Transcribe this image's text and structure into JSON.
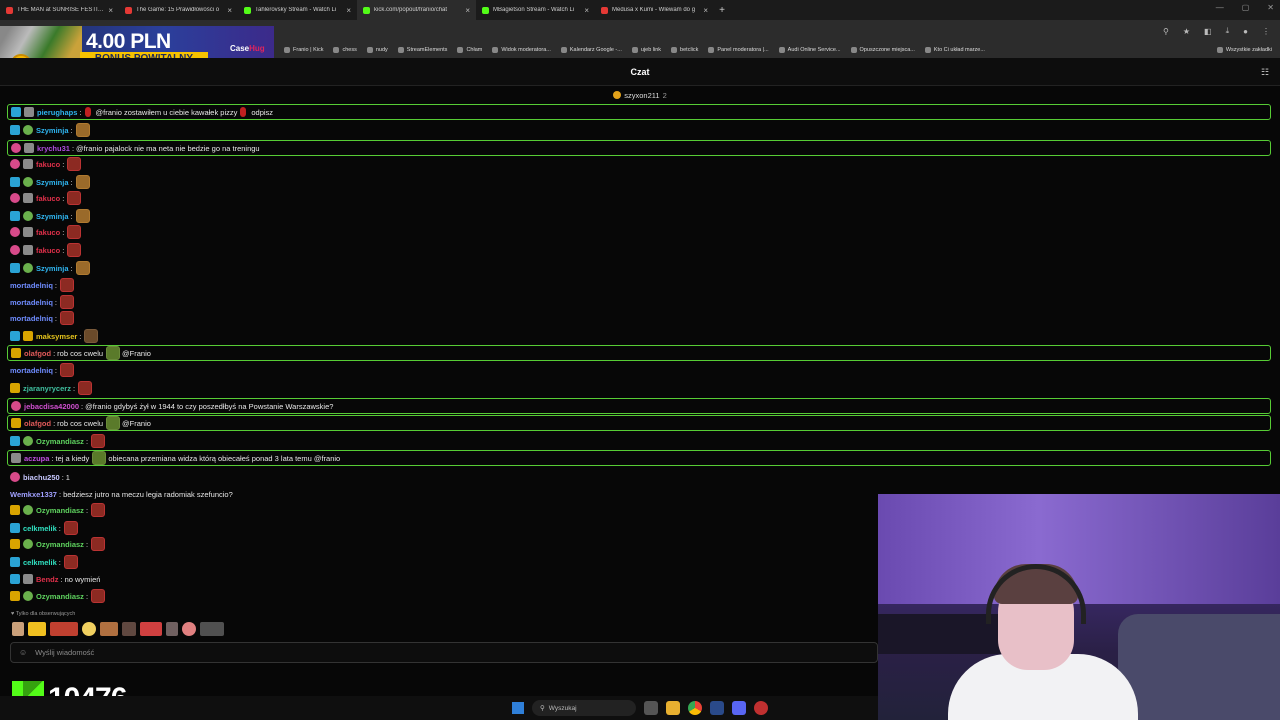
{
  "browser": {
    "tabs": [
      {
        "title": "THE MAN at SUNRISE FESTIVAL",
        "color": "#e53935"
      },
      {
        "title": "The Game: 15 Prawidłowości o",
        "color": "#e53935"
      },
      {
        "title": "Tahlerovsky Stream - Watch Li",
        "color": "#53fc18"
      },
      {
        "title": "kick.com/popout/franio/chat",
        "color": "#53fc18",
        "active": true
      },
      {
        "title": "MBagietson Stream - Watch Li",
        "color": "#53fc18"
      },
      {
        "title": "Medusa x Kumi - Wlewam do g",
        "color": "#e53935"
      }
    ],
    "bookmarks": [
      "Franio | Kick",
      "chess",
      "nudy",
      "StreamElements",
      "Chłam",
      "Widok moderatora...",
      "Kalendarz Google -...",
      "ujeb link",
      "betclick",
      "Panel moderatora |...",
      "Audi Online Service...",
      "Opuszczone miejsca...",
      "Kto Ci układ marze..."
    ],
    "all_bookmarks": "Wszystkie zakładki"
  },
  "promo": {
    "amount": "4.00 PLN",
    "bonus": "BONUS POWITALNY",
    "brand_a": "Case",
    "brand_b": "Hug"
  },
  "chat": {
    "title": "Czat",
    "pinned_user": "szyxon211",
    "pinned_count": "2",
    "messages": [
      {
        "user": "pierughaps",
        "color": "#2fb5f0",
        "badges": [
          "sub",
          "mod"
        ],
        "text": "@franio zostawiłem u ciebie kawałek pizzy",
        "suffix": "odpisz",
        "hl": true,
        "emote": "r"
      },
      {
        "user": "Szyminja",
        "color": "#2fb5f0",
        "badges": [
          "sub",
          "vip"
        ],
        "text": "",
        "emote": "t"
      },
      {
        "user": "krychu31",
        "color": "#b04ee0",
        "badges": [
          "pink",
          "mod"
        ],
        "text": "@franio pajalock nie ma neta nie bedzie go na treningu",
        "hl": true
      },
      {
        "user": "fakuco",
        "color": "#e0304a",
        "badges": [
          "pink",
          "mod"
        ],
        "text": "",
        "emote": "e"
      },
      {
        "user": "Szyminja",
        "color": "#2fb5f0",
        "badges": [
          "sub",
          "vip"
        ],
        "text": "",
        "emote": "t"
      },
      {
        "user": "fakuco",
        "color": "#e0304a",
        "badges": [
          "pink",
          "mod"
        ],
        "text": "",
        "emote": "e"
      },
      {
        "user": "Szyminja",
        "color": "#2fb5f0",
        "badges": [
          "sub",
          "vip"
        ],
        "text": "",
        "emote": "t"
      },
      {
        "user": "fakuco",
        "color": "#e0304a",
        "badges": [
          "pink",
          "mod"
        ],
        "text": "",
        "emote": "e"
      },
      {
        "user": "fakuco",
        "color": "#e0304a",
        "badges": [
          "pink",
          "mod"
        ],
        "text": "",
        "emote": "e"
      },
      {
        "user": "Szyminja",
        "color": "#2fb5f0",
        "badges": [
          "sub",
          "vip"
        ],
        "text": "",
        "emote": "t"
      },
      {
        "user": "mortadelniq",
        "color": "#6f8cff",
        "badges": [],
        "text": "",
        "emote": "e"
      },
      {
        "user": "mortadelniq",
        "color": "#6f8cff",
        "badges": [],
        "text": "",
        "emote": "e"
      },
      {
        "user": "mortadelniq",
        "color": "#6f8cff",
        "badges": [],
        "text": "",
        "emote": "e"
      },
      {
        "user": "maksymser",
        "color": "#e7c51c",
        "badges": [
          "sub",
          "og"
        ],
        "text": "",
        "emote": "p"
      },
      {
        "user": "olafgod",
        "color": "#e05a5a",
        "badges": [
          "og"
        ],
        "text": "rob cos cwelu",
        "suffix": "@Franio",
        "hl": true,
        "emote": "g"
      },
      {
        "user": "mortadelniq",
        "color": "#6f8cff",
        "badges": [],
        "text": "",
        "emote": "e"
      },
      {
        "user": "zjaranyrycerz",
        "color": "#40c0a0",
        "badges": [
          "og"
        ],
        "text": "",
        "emote": "e"
      },
      {
        "user": "jebacdisa42000",
        "color": "#d050d0",
        "badges": [
          "pink"
        ],
        "text": "@franio gdybyś żył w 1944 to czy poszedłbyś na Powstanie Warszawskie?",
        "hl": true
      },
      {
        "user": "olafgod",
        "color": "#e05a5a",
        "badges": [
          "og"
        ],
        "text": "rob cos cwelu",
        "suffix": "@Franio",
        "hl": true,
        "emote": "g"
      },
      {
        "user": "Ozymandiasz",
        "color": "#5fd35f",
        "badges": [
          "sub",
          "vip"
        ],
        "text": "",
        "emote": "e"
      },
      {
        "user": "aczupa",
        "color": "#c050e0",
        "badges": [
          "mod"
        ],
        "text": "tej a kiedy",
        "suffix": "obiecana przemiana widza którą obiecałeś ponad 3 lata temu @franio",
        "hl": true,
        "emote": "y"
      },
      {
        "user": "biachu250",
        "color": "#c8c8ff",
        "badges": [
          "pink"
        ],
        "text": "1"
      },
      {
        "user": "Wemkxe1337",
        "color": "#a0a0ff",
        "badges": [],
        "text": "bedziesz jutro na meczu legia radomiak szefuncio?"
      },
      {
        "user": "Ozymandiasz",
        "color": "#5fd35f",
        "badges": [
          "og",
          "vip"
        ],
        "text": "",
        "emote": "e"
      },
      {
        "user": "celkmelik",
        "color": "#30e0c0",
        "badges": [
          "sub"
        ],
        "text": "",
        "emote": "e"
      },
      {
        "user": "Ozymandiasz",
        "color": "#5fd35f",
        "badges": [
          "og",
          "vip"
        ],
        "text": "",
        "emote": "e"
      },
      {
        "user": "celkmelik",
        "color": "#30e0c0",
        "badges": [
          "sub"
        ],
        "text": "",
        "emote": "e"
      },
      {
        "user": "Bendz",
        "color": "#e0304a",
        "badges": [
          "sub",
          "mod"
        ],
        "text": "no wymień"
      },
      {
        "user": "Ozymandiasz",
        "color": "#5fd35f",
        "badges": [
          "og",
          "vip"
        ],
        "text": "",
        "emote": "e"
      }
    ],
    "followers_only": "Tylko dla obserwujących",
    "input_placeholder": "Wyślij wiadomość"
  },
  "counter": {
    "value": "10476"
  },
  "taskbar": {
    "search_placeholder": "Wyszukaj"
  }
}
